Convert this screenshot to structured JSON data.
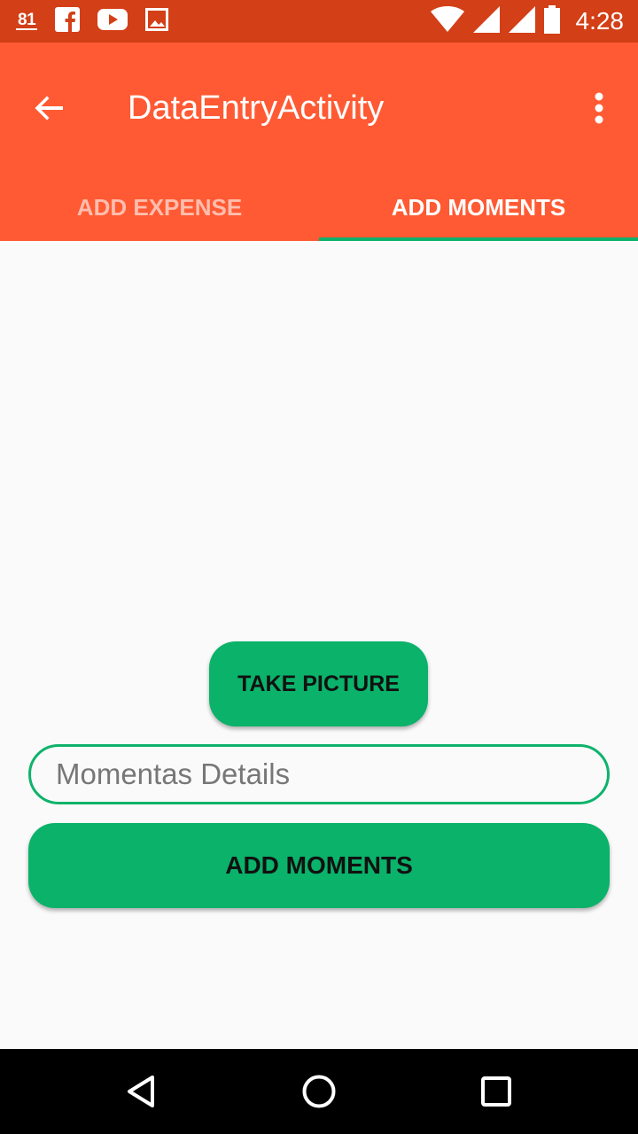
{
  "status_bar": {
    "notification_badge": "81",
    "icons": [
      "calendar-81-icon",
      "facebook-icon",
      "youtube-icon",
      "gallery-icon",
      "wifi-icon",
      "signal-icon",
      "signal-icon",
      "battery-icon"
    ],
    "time": "4:28"
  },
  "app_bar": {
    "title": "DataEntryActivity",
    "back_icon": "arrow-back-icon",
    "menu_icon": "more-vert-icon"
  },
  "tabs": [
    {
      "label": "ADD EXPENSE",
      "selected": false
    },
    {
      "label": "ADD MOMENTS",
      "selected": true
    }
  ],
  "form": {
    "take_picture_label": "TAKE PICTURE",
    "details_placeholder": "Momentas Details",
    "details_value": "",
    "add_moments_label": "ADD MOMENTS"
  },
  "nav_bar": {
    "icons": [
      "back-triangle-icon",
      "home-circle-icon",
      "recents-square-icon"
    ]
  },
  "colors": {
    "status_bar": "#d33f17",
    "app_bar": "#ff5a33",
    "accent": "#0ab26a",
    "background": "#fafafa"
  }
}
